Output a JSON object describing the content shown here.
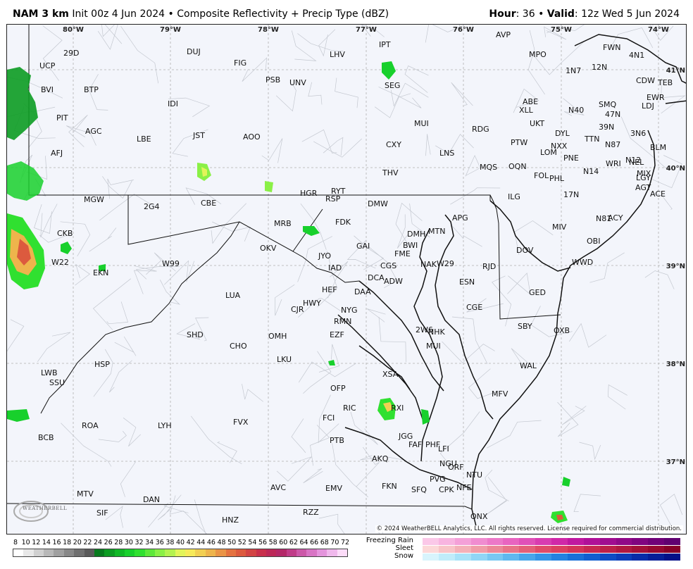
{
  "header": {
    "model": "NAM 3 km",
    "init": "Init 00z 4 Jun 2024",
    "bullet": "•",
    "product": "Composite Reflectivity + Precip Type (dBZ)",
    "hour_label": "Hour",
    "hour_value": ": 36",
    "valid_label": "Valid",
    "valid_value": ": 12z Wed 5 Jun 2024"
  },
  "map": {
    "lon_labels": [
      "80°W",
      "79°W",
      "78°W",
      "77°W",
      "76°W",
      "75°W",
      "74°W"
    ],
    "lat_labels": [
      "41°N",
      "40°N",
      "39°N",
      "38°N",
      "37°N"
    ],
    "stations": [
      "29D",
      "UCP",
      "DUJ",
      "FIG",
      "LHV",
      "IPT",
      "AVP",
      "MPO",
      "FWN",
      "4N1",
      "BVI",
      "BTP",
      "PSB",
      "UNV",
      "SEG",
      "1N7",
      "12N",
      "CDW",
      "TEB",
      "IDI",
      "ABE",
      "XLL",
      "SMQ",
      "47N",
      "EWR",
      "LDJ",
      "PIT",
      "AGC",
      "JST",
      "AOO",
      "MUI",
      "RDG",
      "UKT",
      "N40",
      "39N",
      "3N6",
      "AFJ",
      "LBE",
      "CXY",
      "LNS",
      "PTW",
      "DYL",
      "NXX",
      "TTN",
      "N87",
      "BLM",
      "MQS",
      "OQN",
      "LOM",
      "PNE",
      "N12",
      "THV",
      "FOL",
      "PHL",
      "N14",
      "WRI",
      "NEL",
      "MIX",
      "LGY",
      "HGR",
      "RYT",
      "RSP",
      "ILG",
      "17N",
      "AGT",
      "ACE",
      "MGW",
      "2G4",
      "CBE",
      "DMW",
      "FDK",
      "APG",
      "N81",
      "MRB",
      "GAI",
      "DMH",
      "MTN",
      "MIV",
      "ACY",
      "CKB",
      "OKV",
      "JYO",
      "BWI",
      "FME",
      "DOV",
      "OBI",
      "W22",
      "W99",
      "EKN",
      "IAD",
      "CGS",
      "NAK",
      "W29",
      "RJD",
      "WWD",
      "DCA",
      "ADW",
      "ESN",
      "HEF",
      "DAA",
      "GED",
      "LUA",
      "CJR",
      "HWY",
      "CGE",
      "NYG",
      "RMN",
      "SBY",
      "2W6",
      "NHK",
      "SHD",
      "CHO",
      "OMH",
      "EZF",
      "MUI",
      "OXB",
      "LKU",
      "WAL",
      "HSP",
      "LWB",
      "SSU",
      "XSA",
      "OFP",
      "MFV",
      "RIC",
      "RXI",
      "ROA",
      "LYH",
      "FVX",
      "FCI",
      "BCB",
      "PTB",
      "JGG",
      "FAF",
      "PHF",
      "LFI",
      "AKQ",
      "NGU",
      "ORF",
      "NTU",
      "MTV",
      "DAN",
      "AVC",
      "EMV",
      "FKN",
      "SFQ",
      "PVG",
      "CPK",
      "NFE",
      "SIF",
      "HNZ",
      "RZZ",
      "ONX"
    ],
    "copyright": "© 2024 WeatherBELL Analytics, LLC. All rights reserved. License required for commercial distribution.",
    "logo_text": "WEATHERBELL"
  },
  "legend": {
    "ticks": [
      "8",
      "10",
      "12",
      "14",
      "16",
      "18",
      "20",
      "22",
      "24",
      "26",
      "28",
      "30",
      "32",
      "34",
      "36",
      "38",
      "40",
      "42",
      "44",
      "46",
      "48",
      "50",
      "52",
      "54",
      "56",
      "58",
      "60",
      "62",
      "64",
      "66",
      "68",
      "70",
      "72"
    ],
    "colors": [
      "#ffffff",
      "#e8e8e8",
      "#d0d0d0",
      "#b8b8b8",
      "#a0a0a0",
      "#888888",
      "#707070",
      "#5a5a5a",
      "#087a1e",
      "#0c9c22",
      "#10b826",
      "#18d02c",
      "#30e030",
      "#5ee83a",
      "#8af046",
      "#b4f250",
      "#e2f45a",
      "#f6ea5a",
      "#f2cf52",
      "#eeb44c",
      "#ea9446",
      "#e47240",
      "#dc5a3e",
      "#d24444",
      "#c8304c",
      "#bc2858",
      "#b42868",
      "#c03c88",
      "#cc58a8",
      "#d874c4",
      "#e494dc",
      "#f0b8ec",
      "#fcdcf8"
    ],
    "ptype_labels": [
      "Freezing Rain",
      "Sleet",
      "Snow"
    ],
    "freezing_rain_colors": [
      "#fbc8e8",
      "#f8b4e0",
      "#f4a0d8",
      "#f08cd0",
      "#ec78c8",
      "#e864c0",
      "#e050b8",
      "#d83cb0",
      "#d028a8",
      "#c018a0",
      "#b01098",
      "#a00c90",
      "#900888",
      "#800480",
      "#700078",
      "#600070"
    ],
    "sleet_colors": [
      "#fcd8d8",
      "#f8c4c8",
      "#f4b0b8",
      "#f09ca8",
      "#ec8898",
      "#e87488",
      "#e46078",
      "#e04c68",
      "#dc4060",
      "#d43458",
      "#c82850",
      "#bc2048",
      "#b01840",
      "#a41038",
      "#980830",
      "#880028"
    ],
    "snow_colors": [
      "#d8f4fc",
      "#c0ecfa",
      "#a8e2f8",
      "#90d6f6",
      "#78c8f2",
      "#60b8ee",
      "#48a6ea",
      "#3494e6",
      "#2482e0",
      "#1870d8",
      "#105ed0",
      "#0c4cc4",
      "#0a3cb8",
      "#082ca8",
      "#061e98",
      "#041088"
    ]
  }
}
